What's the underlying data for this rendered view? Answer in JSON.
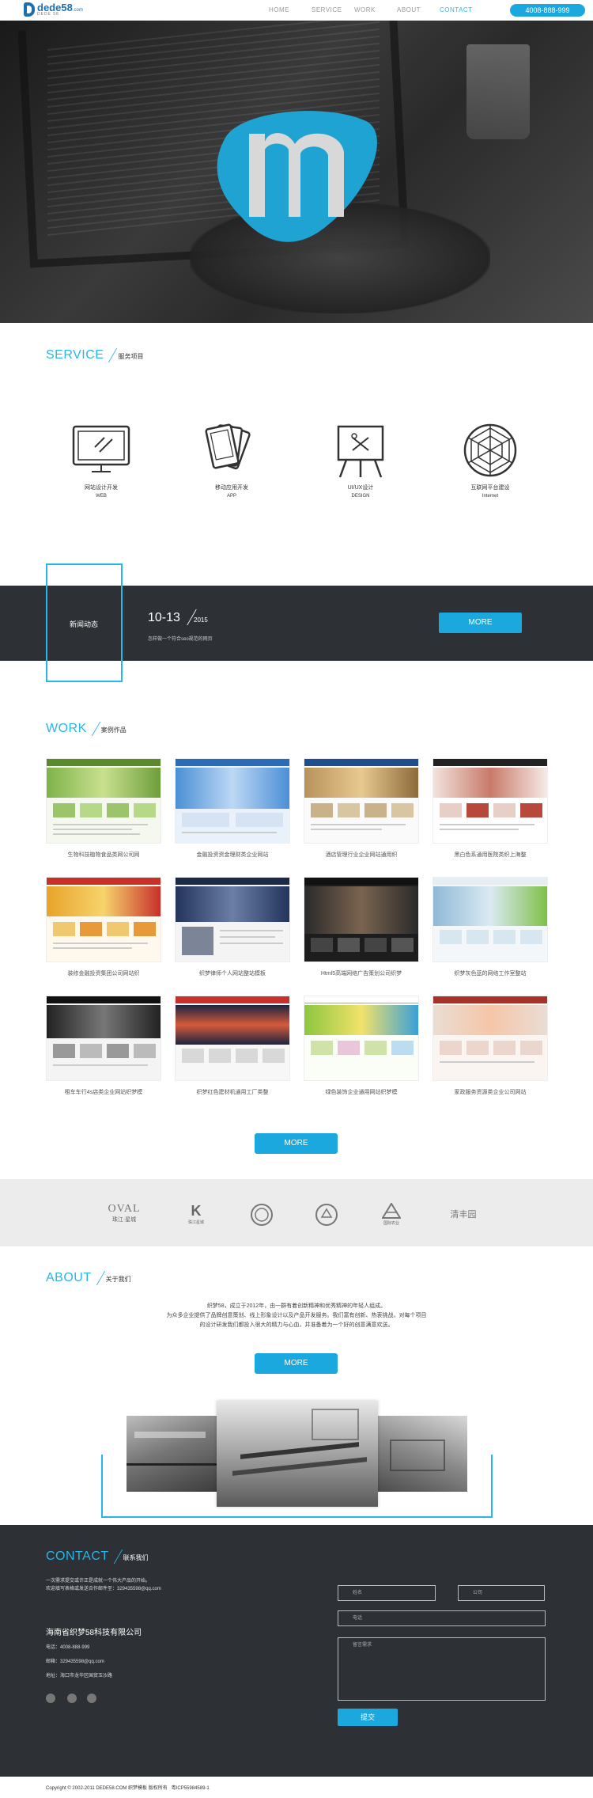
{
  "header": {
    "logo_text": "dede58",
    "logo_domain": ".com",
    "logo_sub": "DEDE 58",
    "nav": [
      "HOME",
      "SERVICE",
      "WORK",
      "ABOUT",
      "CONTACT"
    ],
    "active_nav": "CONTACT",
    "phone": "4008-888-999"
  },
  "service": {
    "title_en": "SERVICE",
    "title_cn": "服务项目",
    "items": [
      {
        "cn": "网站设计开发",
        "en": "WEB",
        "icon": "monitor-icon"
      },
      {
        "cn": "移动应用开发",
        "en": "APP",
        "icon": "mobile-devices-icon"
      },
      {
        "cn": "UI/UX设计",
        "en": "DESIGN",
        "icon": "easel-icon"
      },
      {
        "cn": "互联网平台建设",
        "en": "Internet",
        "icon": "web-icon"
      }
    ]
  },
  "news": {
    "label": "新闻动态",
    "date": "10-13",
    "year": "2015",
    "text": "怎样做一个符合seo规范的网页",
    "more": "MORE"
  },
  "work": {
    "title_en": "WORK",
    "title_cn": "案例作品",
    "items": [
      "生物科技植物食品类网公司网",
      "金融投资资金理财类企业网站",
      "酒店管理行业企业网站通用织",
      "黑白色系通用医院类织上海整",
      "装修金融投资集团公司网站织",
      "织梦律师个人网站整站模板",
      "Html5高端网络广告策划公司织梦",
      "织梦灰色蓝的网络工作室整站",
      "租车车行4s店类企业网站织梦模",
      "织梦红色建材机通用工厂类整",
      "绿色装饰企业通用网站织梦模",
      "家政服务资源类企业公司网站"
    ],
    "more": "MORE"
  },
  "partners": [
    {
      "name": "OVAL",
      "sub": "珠江·星城"
    },
    {
      "name": "K",
      "sub": "珠江星城"
    },
    {
      "name": "seal",
      "sub": ""
    },
    {
      "name": "emblem",
      "sub": ""
    },
    {
      "name": "pyramid",
      "sub": "国际农业"
    },
    {
      "name": "清丰园",
      "sub": ""
    }
  ],
  "about": {
    "title_en": "ABOUT",
    "title_cn": "关于我们",
    "paragraph": [
      "织梦58，成立于2012年，由一群有着创新精神和优秀精神的年轻人组成。",
      "为众多企业提供了品牌创意策划、线上形象设计以及产品开发服务。我们富有创新、热衷挑战，对每个项目",
      "的设计研发我们都投入很大的精力与心血，并准备着为一个好的创意满意欢送。"
    ],
    "more": "MORE"
  },
  "contact": {
    "title_en": "CONTACT",
    "title_cn": "联系我们",
    "line1": "一次需求提交或许正是成就一个伟大产品的开始。",
    "line2": "欢迎填写表格或发送合作邮件至：329435598@qq.com",
    "company": "海南省织梦58科技有限公司",
    "phone": "电话：4008-888-999",
    "email": "邮箱：329435598@qq.com",
    "address": "地址：海口市龙华区国贸玉沙路",
    "placeholders": {
      "name": "姓名",
      "company": "公司",
      "phone": "电话",
      "message": "留言需求"
    },
    "submit": "提交"
  },
  "footer": {
    "copyright": "Copyright © 2002-2011 DEDE58.COM 织梦模板 版权所有",
    "icp": "粤ICP55984589-1"
  },
  "colors": {
    "accent": "#29b6e8",
    "button": "#1ba8df",
    "dark": "#2d3035"
  }
}
